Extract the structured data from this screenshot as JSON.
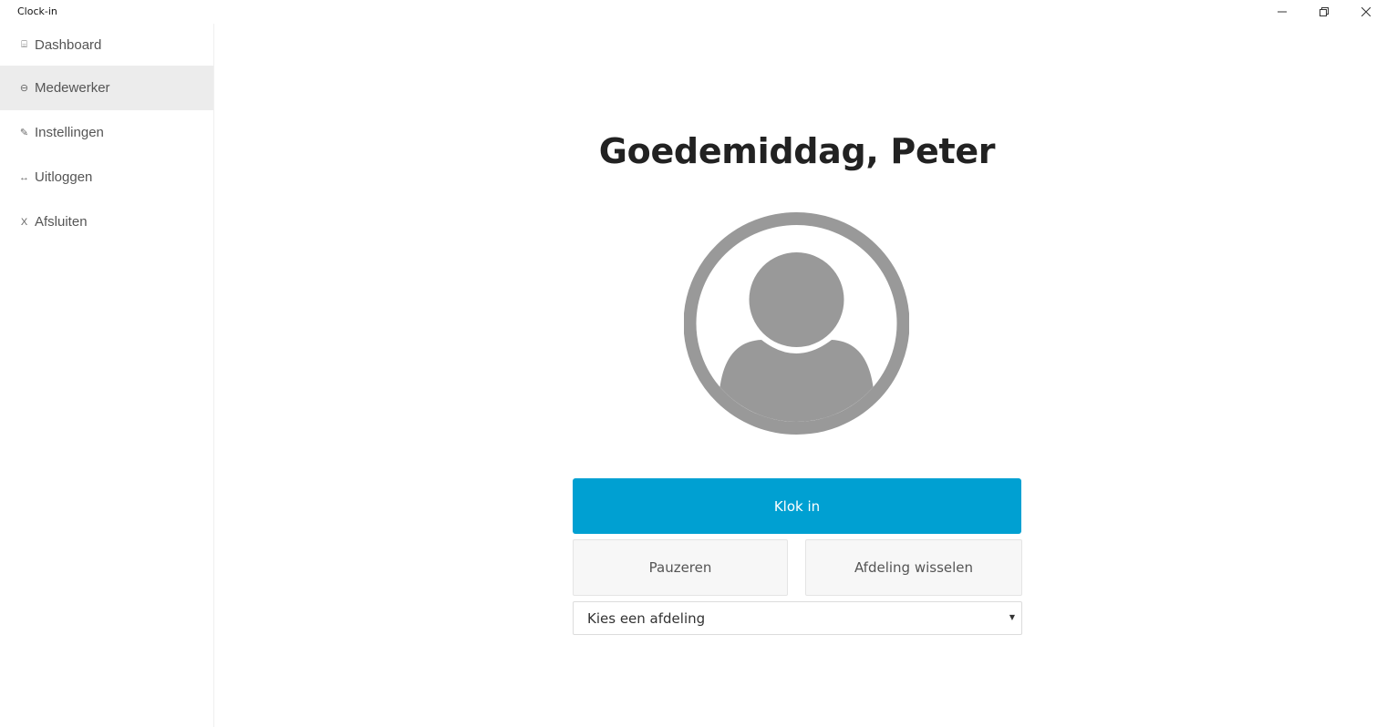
{
  "window": {
    "title": "Clock-in",
    "controls": {
      "minimize_icon": "minimize-icon",
      "restore_icon": "restore-icon",
      "close_icon": "close-icon"
    }
  },
  "sidebar": {
    "items": [
      {
        "label": "Dashboard",
        "icon": "dashboard-icon",
        "glyph": "⌸",
        "active": false
      },
      {
        "label": "Medewerker",
        "icon": "user-icon",
        "glyph": "⊖",
        "active": true
      },
      {
        "label": "Instellingen",
        "icon": "pen-icon",
        "glyph": "✎",
        "active": false
      },
      {
        "label": "Uitloggen",
        "icon": "logout-icon",
        "glyph": "↔",
        "active": false
      },
      {
        "label": "Afsluiten",
        "icon": "close-app-icon",
        "glyph": "X",
        "active": false
      }
    ]
  },
  "main": {
    "greeting": "Goedemiddag, Peter",
    "avatar_icon": "user-avatar-icon",
    "clock_in_label": "Klok in",
    "pause_label": "Pauzeren",
    "switch_department_label": "Afdeling wisselen",
    "department_select": {
      "selected": "Kies een afdeling"
    }
  },
  "colors": {
    "primary": "#00a0d2",
    "avatar": "#999999",
    "active_nav": "#ececec"
  }
}
